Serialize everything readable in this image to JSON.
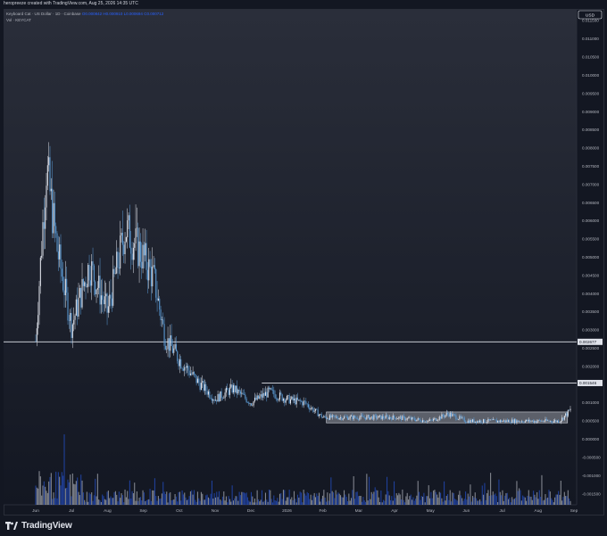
{
  "caption": "heropreeze created with TradingView.com, Aug 25, 2026 14:35 UTC",
  "legend": {
    "symbol": "Keyboard Cat · US Dollar · 1D · Coinbase",
    "open": "O0.000842",
    "high": "H0.000910",
    "low": "L0.000694",
    "close": "C0.000712",
    "volume": "Vol · KEYCAT"
  },
  "currency_button": "USD",
  "brand": "TradingView",
  "colors": {
    "background": "#131722",
    "up": "#e0e3eb",
    "down": "#2962ff",
    "line": "#5b9bd5"
  },
  "chart_data": {
    "type": "candlestick",
    "title": "Keyboard Cat · US Dollar · 1D · Coinbase",
    "x_tick_labels": [
      "Jun",
      "Jul",
      "Aug",
      "Sep",
      "Oct",
      "Nov",
      "Dec",
      "2026",
      "Feb",
      "Mar",
      "Apr",
      "May",
      "Jun",
      "Jul",
      "Aug",
      "Sep"
    ],
    "y_tick_labels": [
      "0.011500",
      "0.011000",
      "0.010500",
      "0.010000",
      "0.009500",
      "0.009000",
      "0.008500",
      "0.008000",
      "0.007500",
      "0.007000",
      "0.006500",
      "0.006000",
      "0.005500",
      "0.005000",
      "0.004500",
      "0.004000",
      "0.003500",
      "0.003000",
      "0.002500",
      "0.002000",
      "0.001500",
      "0.001000",
      "0.000500",
      "0.000000",
      "-0.000500",
      "-0.001000",
      "-0.001500"
    ],
    "ylim": [
      -0.0018,
      0.0118
    ],
    "horizontal_lines": [
      {
        "value": 0.002677,
        "label": "0.002677"
      },
      {
        "value": 0.001546,
        "label": "0.001546"
      }
    ],
    "range_box": {
      "from": "2026-02",
      "to": "2026-08-25",
      "low": 0.00045,
      "high": 0.00075
    },
    "series": [
      {
        "price_path_month_index": [
          0,
          0.3,
          0.6,
          1.0,
          1.5,
          2.0,
          2.5,
          3.0,
          3.3,
          3.6,
          4.0,
          4.5,
          5.0,
          5.5,
          6.0,
          6.5,
          7.0,
          7.5,
          8.0,
          8.5,
          9.0,
          10.0,
          11.0,
          11.5,
          12.0,
          13.0,
          14.0,
          14.6,
          14.9
        ],
        "price_path_values": [
          0.0027,
          0.0075,
          0.0052,
          0.0031,
          0.0048,
          0.0035,
          0.0058,
          0.005,
          0.0044,
          0.0028,
          0.0022,
          0.0016,
          0.0011,
          0.0014,
          0.001,
          0.0013,
          0.0011,
          0.001,
          0.0006,
          0.0006,
          0.0006,
          0.0006,
          0.0005,
          0.0007,
          0.0005,
          0.0005,
          0.0005,
          0.0005,
          0.0008
        ]
      }
    ]
  }
}
